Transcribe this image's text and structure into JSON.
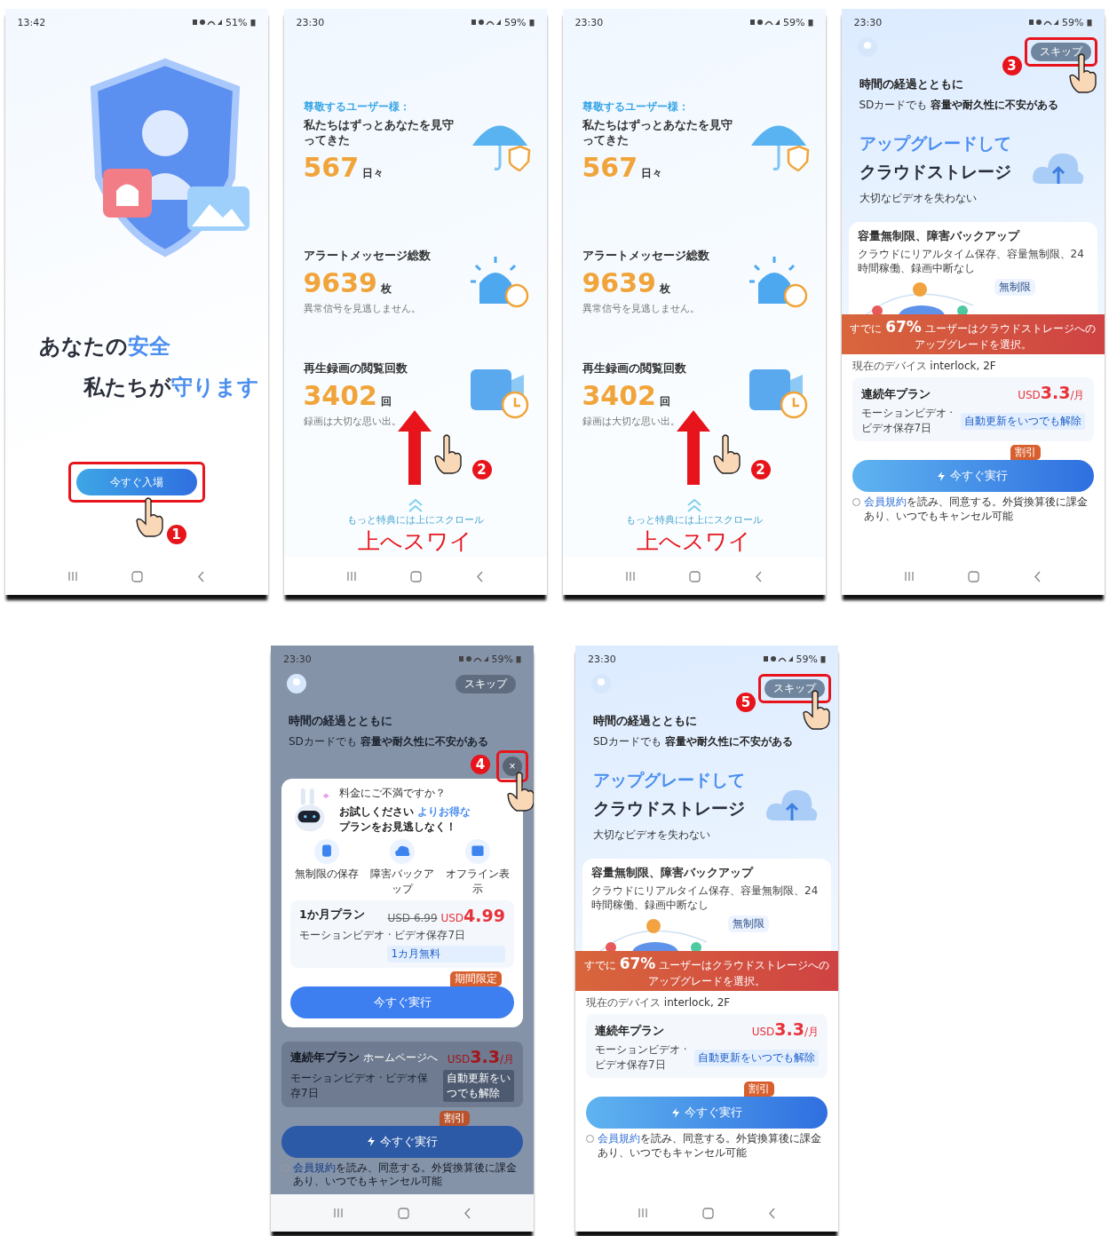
{
  "rows": [
    {
      "phones": [
        {
          "kind": "welcome",
          "time": "13:42",
          "battery": "51%",
          "title_plain": "あなたの",
          "title_accent": "安全",
          "subtitle_plain": "私たちが",
          "subtitle_accent": "守ります",
          "button": "今すぐ入場",
          "step": "1"
        },
        {
          "kind": "stats",
          "time": "23:30",
          "battery": "59%",
          "greeting": "尊敬するユーザー様：",
          "stats": [
            {
              "kind": "umbrella",
              "label": "私たちはずっとあなたを見守ってきた",
              "value": "567",
              "unit": "日々"
            },
            {
              "kind": "alarm",
              "label": "アラートメッセージ総数",
              "value": "9639",
              "unit": "枚",
              "note": "異常信号を見逃しません。"
            },
            {
              "kind": "video",
              "label": "再生録画の閲覧回数",
              "value": "3402",
              "unit": "回",
              "note": "録画は大切な思い出。"
            }
          ],
          "scroll_hint": "もっと特典には上にスクロール",
          "caption": "上へスワイ",
          "step": "2"
        },
        {
          "kind": "stats",
          "time": "23:30",
          "battery": "59%",
          "greeting": "尊敬するユーザー様：",
          "stats": [
            {
              "kind": "umbrella",
              "label": "私たちはずっとあなたを見守ってきた",
              "value": "567",
              "unit": "日々"
            },
            {
              "kind": "alarm",
              "label": "アラートメッセージ総数",
              "value": "9639",
              "unit": "枚",
              "note": "異常信号を見逃しません。"
            },
            {
              "kind": "video",
              "label": "再生録画の閲覧回数",
              "value": "3402",
              "unit": "回",
              "note": "録画は大切な思い出。"
            }
          ],
          "scroll_hint": "もっと特典には上にスクロール",
          "caption": "上へスワイ",
          "step": "2"
        },
        {
          "kind": "upgrade",
          "time": "23:30",
          "battery": "59%",
          "skip": "スキップ",
          "heading": "時間の経過とともに",
          "sub_plain": "SDカードでも",
          "sub_bold": "容量や耐久性に不安がある",
          "title_accent": "アップグレードして",
          "title": "クラウドストレージ",
          "tagline": "大切なビデオを失わない",
          "feature_title": "容量無制限、障害バックアップ",
          "feature_desc": "クラウドにリアルタイム保存、容量無制限、24時間稼働、録画中断なし",
          "bubble": "無制限",
          "banner_plain": "すでに",
          "banner_percent": "67%",
          "banner_rest": "ユーザーはクラウドストレージへのアップグレードを選択。",
          "device_label": "現在のデバイス",
          "device_name": "interlock, 2F",
          "plan": {
            "name": "連続年プラン",
            "desc": "モーションビデオ · ビデオ保存7日",
            "currency": "USD",
            "price": "3.3",
            "unit": "/月",
            "note": "自動更新をいつでも解除"
          },
          "badge": "割引",
          "button": "今すぐ実行",
          "agreed": false,
          "terms_link": "会員規約",
          "terms": "を読み、同意する。外貨換算後に課金あり、いつでもキャンセル可能",
          "step": "3"
        }
      ]
    },
    {
      "phones": [
        {
          "kind": "popup",
          "time": "23:30",
          "battery": "59%",
          "skip": "スキップ",
          "heading": "時間の経過とともに",
          "sub_plain": "SDカードでも",
          "sub_bold": "容量や耐久性に不安がある",
          "toast": "ホームページへ",
          "plan": {
            "name": "連続年プラン",
            "desc": "モーションビデオ · ビデオ保存7日",
            "currency": "USD",
            "price": "3.3",
            "unit": "/月",
            "note": "自動更新をいつでも解除"
          },
          "badge": "割引",
          "button": "今すぐ実行",
          "agreed": false,
          "terms_link": "会員規約",
          "terms": "を読み、同意する。外貨換算後に課金あり、いつでもキャンセル可能",
          "step": "4",
          "popup": {
            "close": "×",
            "title": "料金にご不満ですか？",
            "line1_plain": "お試しください",
            "line1_accent": "よりお得な",
            "line2": "プランをお見逃しなく！",
            "features": [
              {
                "kind": "storage",
                "label": "無制限の保存"
              },
              {
                "kind": "cloud",
                "label": "障害バックアップ"
              },
              {
                "kind": "screen",
                "label": "オフライン表示"
              }
            ],
            "plan_name": "1か月プラン",
            "plan_desc": "モーションビデオ · ビデオ保存7日",
            "old_price": "USD 6.99",
            "currency": "USD",
            "price": "4.99",
            "note": "1カ月無料",
            "badge": "期間限定",
            "button": "今すぐ実行"
          }
        },
        {
          "kind": "upgrade",
          "time": "23:30",
          "battery": "59%",
          "skip": "スキップ",
          "heading": "時間の経過とともに",
          "sub_plain": "SDカードでも",
          "sub_bold": "容量や耐久性に不安がある",
          "title_accent": "アップグレードして",
          "title": "クラウドストレージ",
          "tagline": "大切なビデオを失わない",
          "feature_title": "容量無制限、障害バックアップ",
          "feature_desc": "クラウドにリアルタイム保存、容量無制限、24時間稼働、録画中断なし",
          "bubble": "無制限",
          "banner_plain": "すでに",
          "banner_percent": "67%",
          "banner_rest": "ユーザーはクラウドストレージへのアップグレードを選択。",
          "device_label": "現在のデバイス",
          "device_name": "interlock, 2F",
          "plan": {
            "name": "連続年プラン",
            "desc": "モーションビデオ · ビデオ保存7日",
            "currency": "USD",
            "price": "3.3",
            "unit": "/月",
            "note": "自動更新をいつでも解除"
          },
          "badge": "割引",
          "button": "今すぐ実行",
          "agreed": false,
          "terms_link": "会員規約",
          "terms": "を読み、同意する。外貨換算後に課金あり、いつでもキャンセル可能",
          "step": "5"
        }
      ]
    }
  ]
}
